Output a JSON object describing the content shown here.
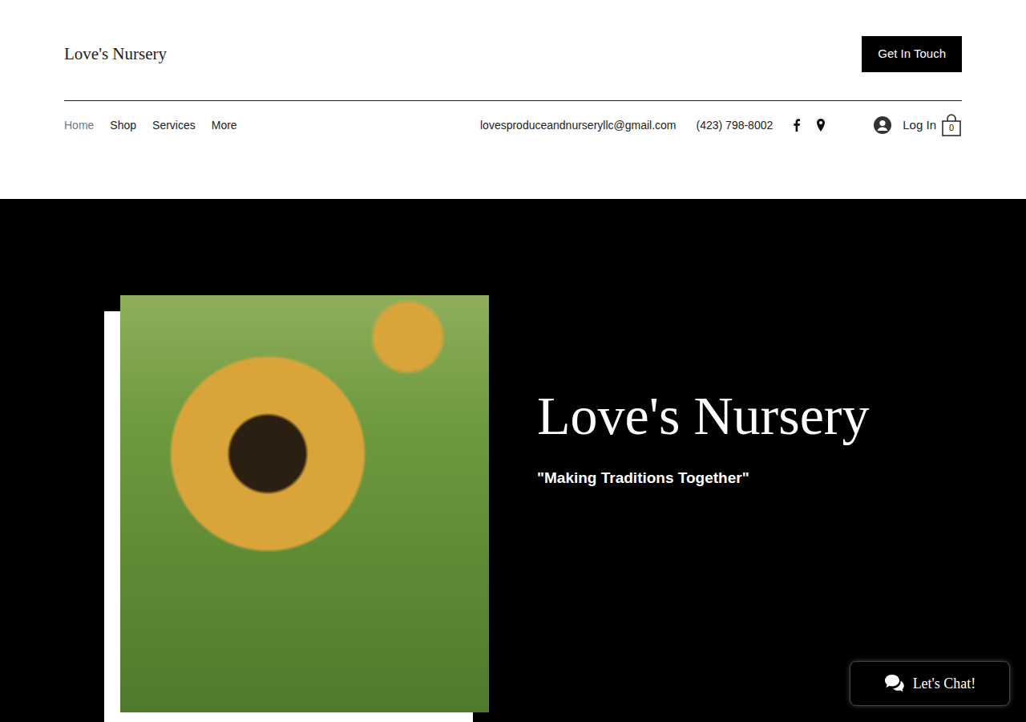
{
  "header": {
    "logo": "Love's Nursery",
    "cta": "Get In Touch"
  },
  "nav": [
    {
      "label": "Home",
      "selected": true
    },
    {
      "label": "Shop",
      "selected": false
    },
    {
      "label": "Services",
      "selected": false
    },
    {
      "label": "More",
      "selected": false
    }
  ],
  "contact": {
    "email": "lovesproduceandnurseryllc@gmail.com",
    "phone": "(423) 798-8002"
  },
  "account": {
    "login": "Log In",
    "cart_count": "0"
  },
  "hero": {
    "title": "Love's Nursery",
    "tagline": "\"Making Traditions Together\""
  },
  "chat": {
    "label": "Let's Chat!"
  }
}
